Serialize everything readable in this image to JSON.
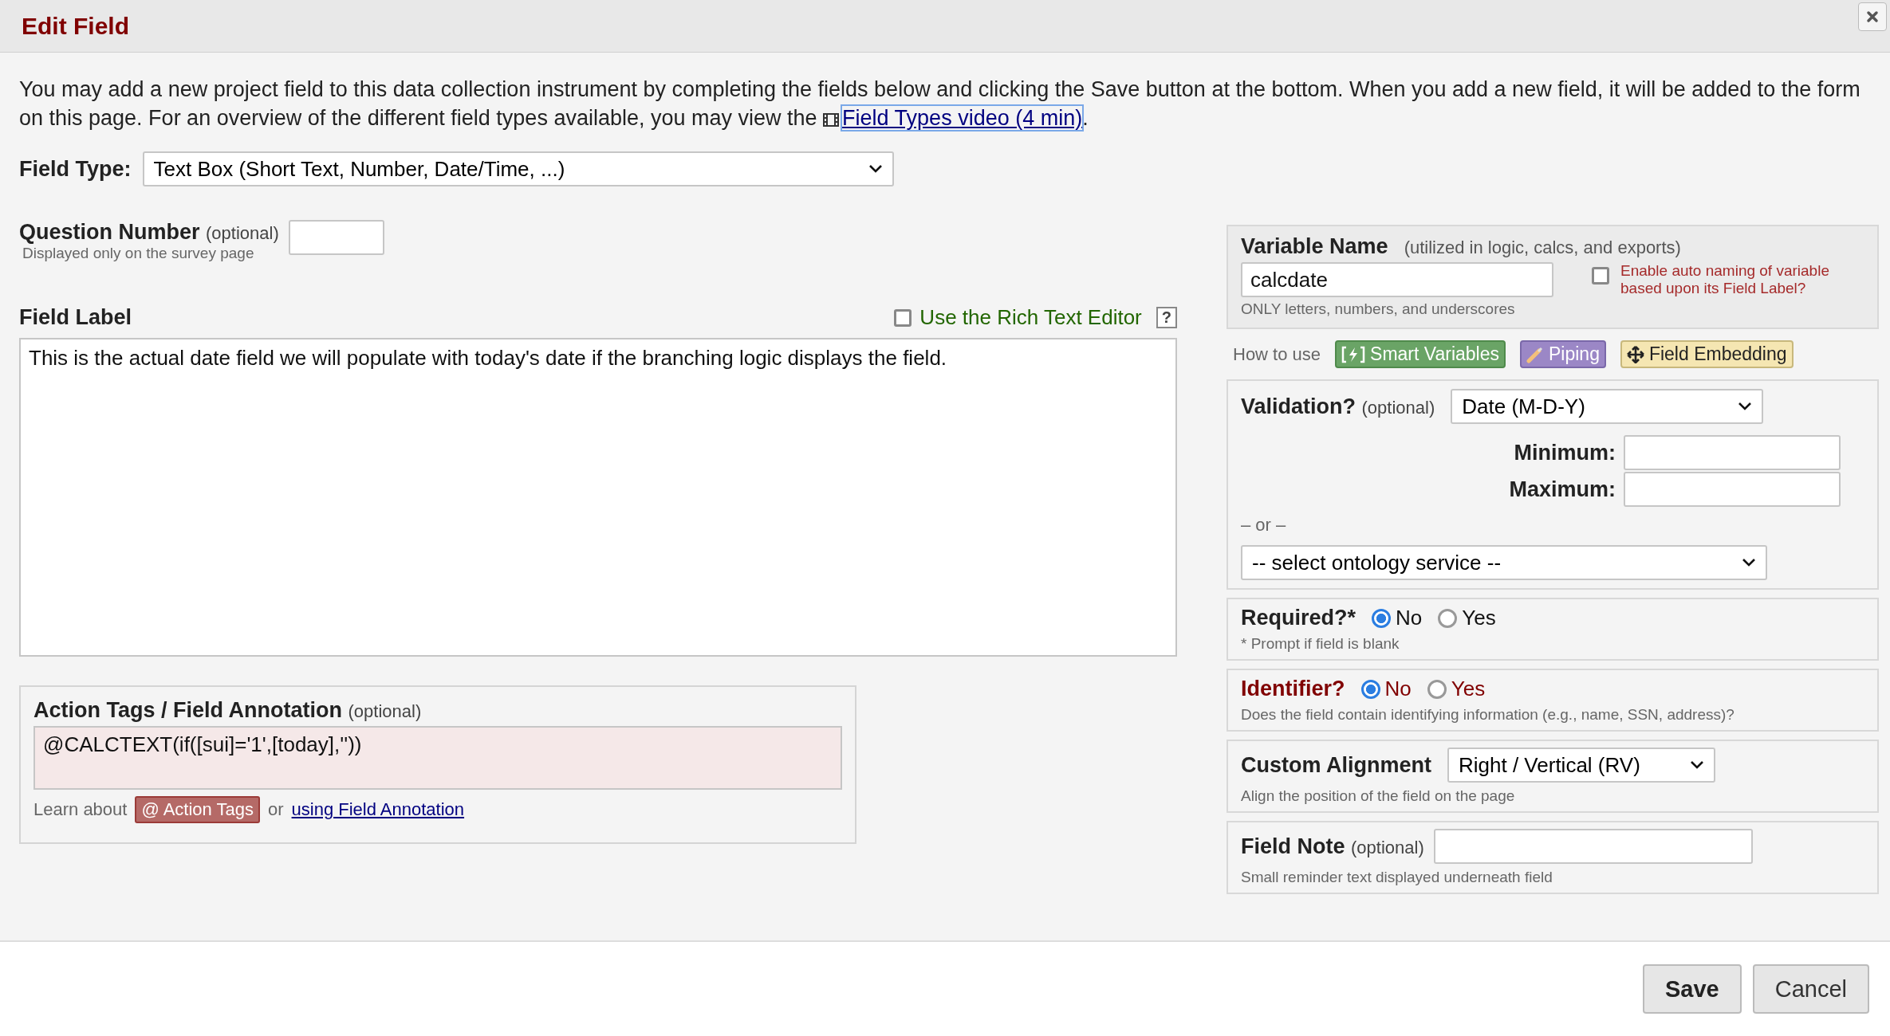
{
  "dialog": {
    "title": "Edit Field"
  },
  "intro": {
    "text": "You may add a new project field to this data collection instrument by completing the fields below and clicking the Save button at the bottom. When you add a new field, it will be added to the form on this page. For an overview of the different field types available, you may view the",
    "link": "Field Types video (4 min)",
    "end": "."
  },
  "field_type": {
    "label": "Field Type:",
    "value": "Text Box (Short Text, Number, Date/Time, ...)"
  },
  "question_number": {
    "label": "Question Number",
    "optional": "(optional)",
    "hint": "Displayed only on the survey page"
  },
  "field_label": {
    "label": "Field Label",
    "rich_text_editor": {
      "label": "Use the Rich Text Editor",
      "checked": false
    },
    "help": "?",
    "value": "This is the actual date field we will populate with today's date if the branching logic displays the field."
  },
  "action_tags": {
    "label": "Action Tags / Field Annotation",
    "optional": "(optional)",
    "value": "@CALCTEXT(if([sui]='1',[today],''))",
    "learn": "Learn about",
    "button": "@ Action Tags",
    "or": "or",
    "link": "using Field Annotation"
  },
  "variable_name": {
    "label": "Variable Name",
    "note": "(utilized in logic, calcs, and exports)",
    "value": "calcdate",
    "hint": "ONLY letters, numbers, and underscores",
    "auto_naming": {
      "label": "Enable auto naming of variable based upon its Field Label?",
      "checked": false
    }
  },
  "how_to_use": {
    "label": "How to use",
    "buttons": [
      {
        "kind": "smart",
        "label": "Smart Variables"
      },
      {
        "kind": "piping",
        "label": "Piping"
      },
      {
        "kind": "embedding",
        "label": "Field Embedding"
      }
    ]
  },
  "validation": {
    "label": "Validation?",
    "optional": "(optional)",
    "value": "Date (M-D-Y)",
    "minimum": "Minimum:",
    "maximum": "Maximum:",
    "or": "– or –",
    "ontology": "-- select ontology service --"
  },
  "required": {
    "label": "Required?*",
    "options": [
      {
        "label": "No",
        "selected": true
      },
      {
        "label": "Yes",
        "selected": false
      }
    ],
    "hint": "* Prompt if field is blank"
  },
  "identifier": {
    "label": "Identifier?",
    "options": [
      {
        "label": "No",
        "selected": true
      },
      {
        "label": "Yes",
        "selected": false
      }
    ],
    "hint": "Does the field contain identifying information (e.g., name, SSN, address)?"
  },
  "alignment": {
    "label": "Custom Alignment",
    "value": "Right / Vertical (RV)",
    "hint": "Align the position of the field on the page"
  },
  "field_note": {
    "label": "Field Note",
    "optional": "(optional)",
    "hint": "Small reminder text displayed underneath field"
  },
  "footer": {
    "buttons": [
      {
        "kind": "primary",
        "label": "Save"
      },
      {
        "kind": "secondary",
        "label": "Cancel"
      }
    ]
  }
}
